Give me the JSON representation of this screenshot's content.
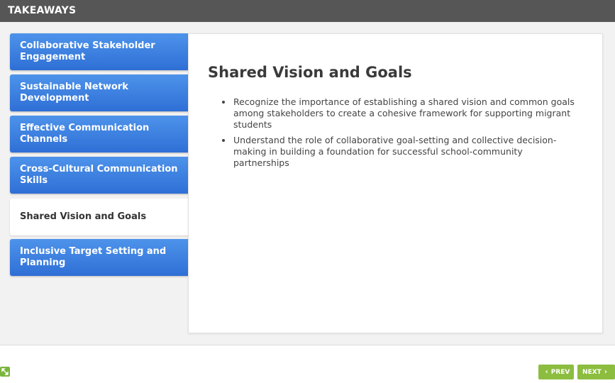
{
  "header": {
    "title": "TAKEAWAYS"
  },
  "tabs": [
    {
      "label": "Collaborative Stakeholder Engagement",
      "active": false
    },
    {
      "label": "Sustainable Network Development",
      "active": false
    },
    {
      "label": "Effective Communication Channels",
      "active": false
    },
    {
      "label": "Cross-Cultural Communication Skills",
      "active": false
    },
    {
      "label": "Shared Vision and Goals",
      "active": true
    },
    {
      "label": "Inclusive Target Setting and Planning",
      "active": false
    }
  ],
  "content": {
    "title": "Shared Vision and Goals",
    "bullets": [
      "Recognize the importance of establishing a shared vision and common goals among stakeholders to create a cohesive framework for supporting migrant students",
      "Understand the role of collaborative goal-setting and collective decision-making in building a foundation for successful school-community partnerships"
    ]
  },
  "footer": {
    "expand_icon": "expand-arrows-icon",
    "prev_label": "PREV",
    "next_label": "NEXT"
  },
  "colors": {
    "header_bg": "#565656",
    "tab_blue": "#3a7fe0",
    "button_green": "#8cbd3f"
  }
}
